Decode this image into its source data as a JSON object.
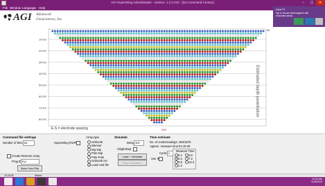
{
  "window": {
    "title": "AGI SuperSting Administrator - version: 1.3.3.210 - [S4 Command Creator]",
    "min": "–",
    "max": "▢",
    "close": "✕"
  },
  "menu": [
    "File",
    "Window",
    "Language",
    "Help"
  ],
  "brand": {
    "name": "AGI",
    "line1": "Advanced",
    "line2": "Geosciences, Inc."
  },
  "toast": {
    "title": "Dane P1",
    "body": "Tap to choose what happens with removable drives."
  },
  "plot": {
    "depth_labels": [
      "10 ES",
      "20 ES",
      "30 ES",
      "40 ES",
      "50 ES",
      "60 ES",
      "70 ES",
      "80 ES"
    ],
    "legend": "E.S = electrode spacing",
    "depth_axis_title": "Estimated depth penetration",
    "top_right_value": "84",
    "bottom_value": "008"
  },
  "command": {
    "title": "Command file settings",
    "num_elec_label": "Number of Elecs:",
    "num_elec_value": "84",
    "ss_label": "SuperSting R1/IP",
    "reverse_label": "Create Reverse Array",
    "prog_label": "Prog ID:",
    "prog_value": "Ect",
    "save_btn": "Save Cmd File"
  },
  "array": {
    "title": "Array type",
    "options": [
      "Schlumb",
      "Wenner",
      "Dip-Dip",
      "Pole-Dip",
      "Pole-Pole",
      "Schlumb inv",
      "Load cmd file"
    ],
    "selected": 6
  },
  "simulate": {
    "title": "Simulate",
    "delay_label": "Delay",
    "delay_value": "300",
    "single_step_label": "SingleStep",
    "load_btn": "Load + Simulate",
    "stop_btn": "Stop simulation"
  },
  "time": {
    "title": "Time estimate",
    "readings_label": "No. of cmds/readings:",
    "readings_value": "450/1679",
    "measure_label": "Approx. measure time:",
    "measure_value": "01:10:40",
    "cycles_label": "Cycles",
    "cycles_value": "2",
    "use_ip_label": "Use IP",
    "mt_title": "Measure Time",
    "mt_options": [
      "0.2",
      "0.4",
      "0.8",
      "1.2",
      "3.6",
      "7.2",
      "14.4"
    ]
  },
  "status": {
    "time": "10:25:30",
    "label": "Status:"
  },
  "taskbar": {
    "clock_time": "10:26 AM",
    "clock_date": "1/16/2013"
  },
  "colors": {
    "rows": [
      "#2f5fd8",
      "#58d8e8",
      "#ffffff",
      "#18a018",
      "#c81818",
      "#2f5fd8",
      "#58d8e8",
      "#d8d010",
      "#18a018",
      "#c81818",
      "#2f5fd8",
      "#58d8e8",
      "#ffffff",
      "#18a018",
      "#c81818",
      "#2f5fd8",
      "#58d8e8",
      "#d8d010",
      "#18a018",
      "#c81818",
      "#2f5fd8",
      "#58d8e8",
      "#ffffff",
      "#18a018",
      "#c81818",
      "#2f5fd8",
      "#58d8e8",
      "#d8d010",
      "#18a018",
      "#c81818",
      "#2f5fd8",
      "#58d8e8",
      "#ffffff",
      "#18a018",
      "#c81818",
      "#2f5fd8",
      "#58d8e8",
      "#d8d010",
      "#18a018",
      "#c81818",
      "#2f5fd8"
    ]
  }
}
